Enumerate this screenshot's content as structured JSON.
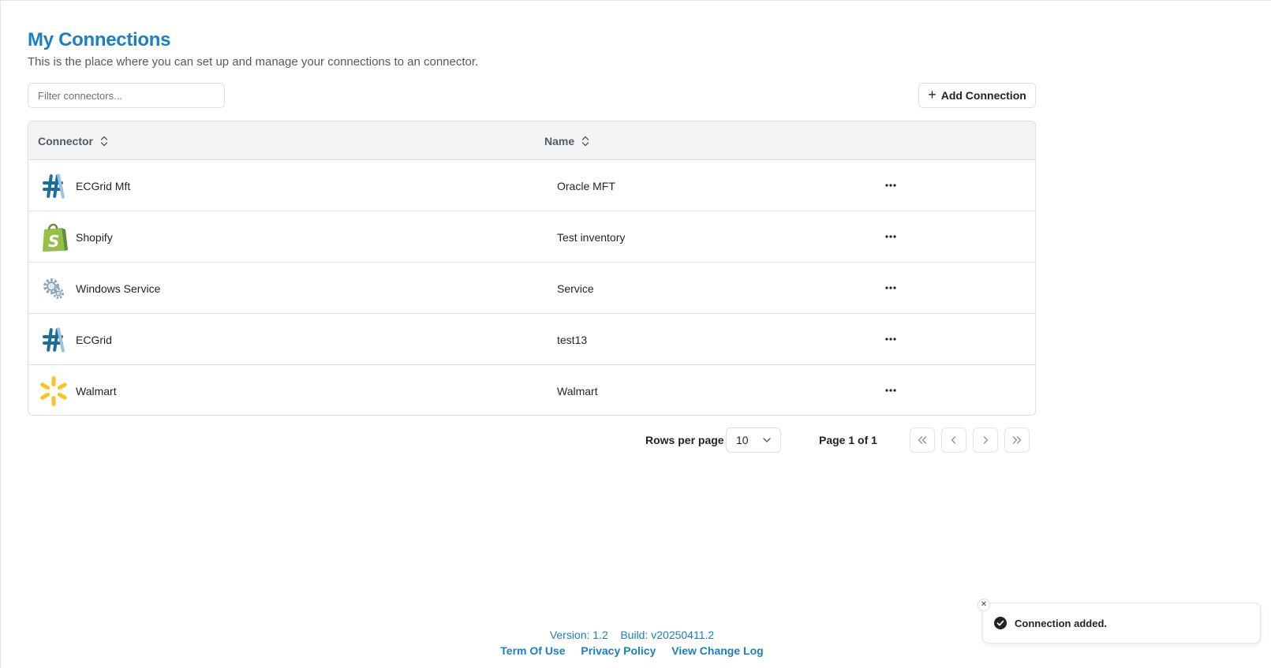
{
  "page": {
    "title": "My Connections",
    "subtitle": "This is the place where you can set up and manage your connections to an connector."
  },
  "filter": {
    "placeholder": "Filter connectors..."
  },
  "add_button": {
    "label": "Add Connection",
    "icon": "plus-icon"
  },
  "table": {
    "columns": [
      {
        "label": "Connector",
        "sortable": true
      },
      {
        "label": "Name",
        "sortable": true
      }
    ],
    "rows": [
      {
        "connector": "ECGrid Mft",
        "name": "Oracle MFT",
        "logo": "ecgrid-logo"
      },
      {
        "connector": "Shopify",
        "name": "Test inventory",
        "logo": "shopify-logo"
      },
      {
        "connector": "Windows Service",
        "name": "Service",
        "logo": "windows-service-gear-logo"
      },
      {
        "connector": "ECGrid",
        "name": "test13",
        "logo": "ecgrid-logo"
      },
      {
        "connector": "Walmart",
        "name": "Walmart",
        "logo": "walmart-spark-logo"
      }
    ]
  },
  "pagination": {
    "rows_per_page_label": "Rows per page",
    "rows_per_page_value": "10",
    "page_info": "Page 1 of 1"
  },
  "footer": {
    "version_label": "Version:",
    "version_value": "1.2",
    "build_label": "Build:",
    "build_value": "v20250411.2",
    "links": [
      "Term Of Use",
      "Privacy Policy",
      "View Change Log"
    ]
  },
  "toast": {
    "message": "Connection added.",
    "icon": "check-circle-icon"
  },
  "colors": {
    "brand_blue": "#1b7fc4",
    "header_bg": "#f3f4f6",
    "border": "#dcdfe3"
  }
}
